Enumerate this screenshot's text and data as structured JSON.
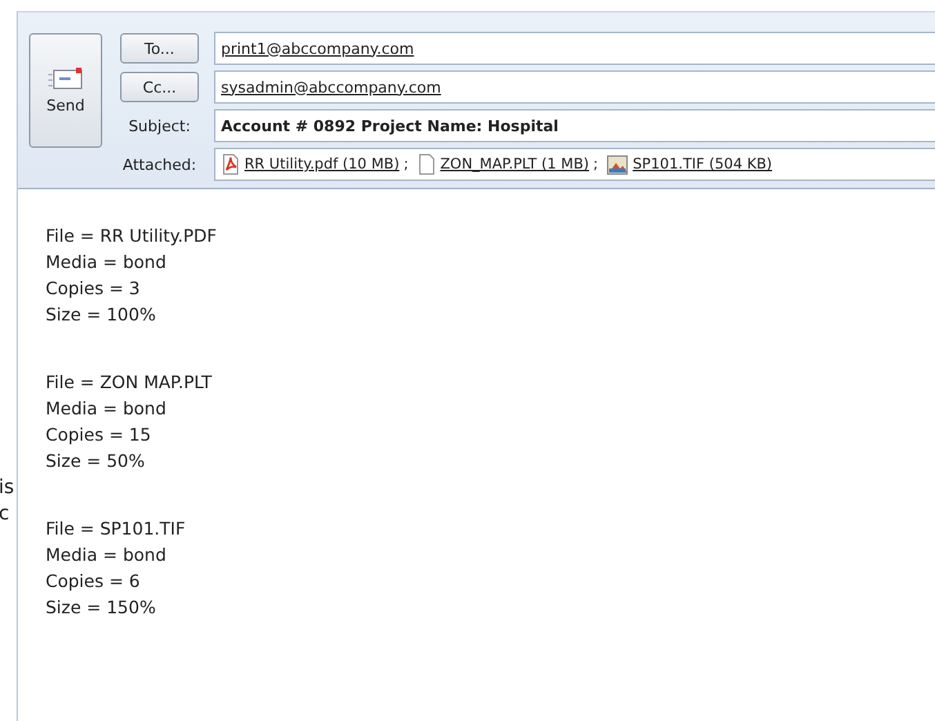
{
  "background_text": [
    "is",
    "c"
  ],
  "header": {
    "send": "Send",
    "recipients": [
      {
        "button": "To...",
        "value": "print1@abccompany.com"
      },
      {
        "button": "Cc...",
        "value": "sysadmin@abccompany.com"
      }
    ],
    "subject": {
      "label": "Subject:",
      "value": "Account # 0892   Project Name: Hospital"
    },
    "attached": {
      "label": "Attached:",
      "files": [
        {
          "kind": "pdf",
          "name": "RR Utility.pdf (10 MB)",
          "sep": ";"
        },
        {
          "kind": "file",
          "name": "ZON_MAP.PLT (1 MB)",
          "sep": ";"
        },
        {
          "kind": "image",
          "name": "SP101.TIF (504 KB)"
        }
      ]
    }
  },
  "body": {
    "blocks": [
      [
        "File = RR Utility.PDF",
        "Media = bond",
        "Copies = 3",
        "Size = 100%"
      ],
      [
        "File = ZON MAP.PLT",
        "Media = bond",
        "Copies = 15",
        "Size = 50%"
      ],
      [
        "File = SP101.TIF",
        "Media = bond",
        "Copies = 6",
        "Size = 150%"
      ]
    ]
  }
}
